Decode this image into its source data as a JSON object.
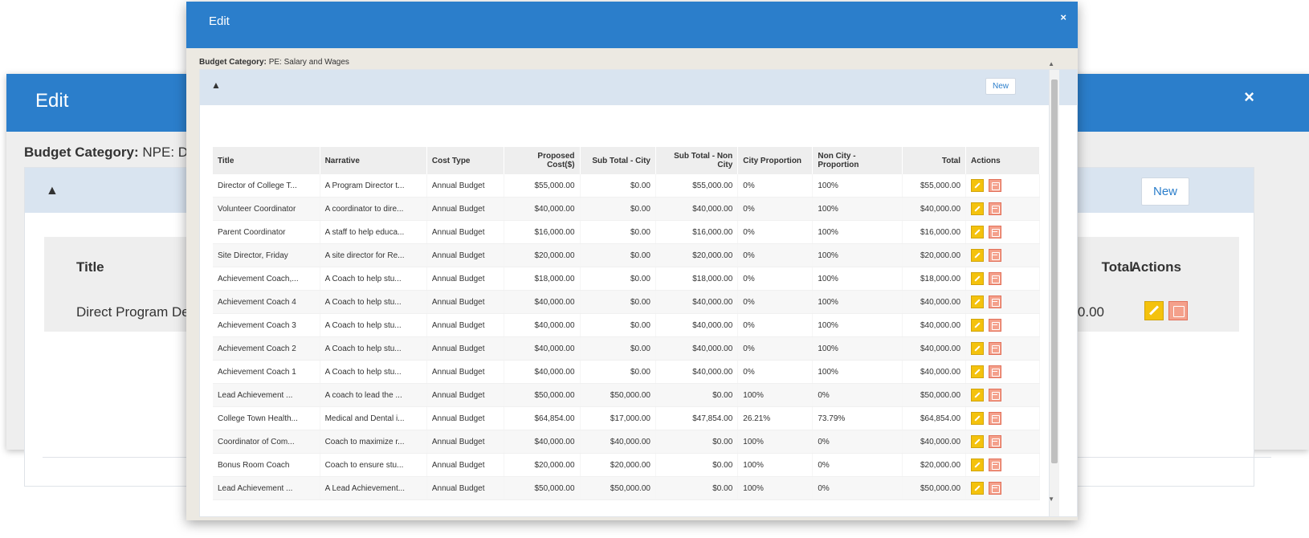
{
  "background_dialog": {
    "title": "Edit",
    "close_icon": "×",
    "budget_label": "Budget Category:",
    "budget_value": "NPE: Dir",
    "collapse_icon": "▲",
    "new_label": "New",
    "columns": {
      "title": "Title",
      "total": "Total",
      "actions": "Actions"
    },
    "row": {
      "title": "Direct Program Deliv...",
      "total": "50.00"
    }
  },
  "dialog": {
    "title": "Edit",
    "close_icon": "×",
    "budget_label": "Budget Category:",
    "budget_value": "PE: Salary and Wages",
    "collapse_icon": "▲",
    "new_label": "New",
    "scroll_up_icon": "▲",
    "scroll_down_icon": "▼",
    "columns": {
      "title": "Title",
      "narrative": "Narrative",
      "cost_type": "Cost Type",
      "proposed": "Proposed Cost($)",
      "sub_city": "Sub Total - City",
      "sub_non": "Sub Total - Non City",
      "city_prop": "City Proportion",
      "non_city_prop": "Non City - Proportion",
      "total": "Total",
      "actions": "Actions"
    },
    "rows": [
      {
        "title": "Director of College T...",
        "narrative": "A Program Director t...",
        "cost_type": "Annual Budget",
        "proposed": "$55,000.00",
        "sub_city": "$0.00",
        "sub_non": "$55,000.00",
        "city_prop": "0%",
        "non_city_prop": "100%",
        "total": "$55,000.00"
      },
      {
        "title": "Volunteer Coordinator",
        "narrative": "A coordinator to dire...",
        "cost_type": "Annual Budget",
        "proposed": "$40,000.00",
        "sub_city": "$0.00",
        "sub_non": "$40,000.00",
        "city_prop": "0%",
        "non_city_prop": "100%",
        "total": "$40,000.00"
      },
      {
        "title": "Parent Coordinator",
        "narrative": "A staff to help educa...",
        "cost_type": "Annual Budget",
        "proposed": "$16,000.00",
        "sub_city": "$0.00",
        "sub_non": "$16,000.00",
        "city_prop": "0%",
        "non_city_prop": "100%",
        "total": "$16,000.00"
      },
      {
        "title": "Site Director, Friday",
        "narrative": "A site director for Re...",
        "cost_type": "Annual Budget",
        "proposed": "$20,000.00",
        "sub_city": "$0.00",
        "sub_non": "$20,000.00",
        "city_prop": "0%",
        "non_city_prop": "100%",
        "total": "$20,000.00"
      },
      {
        "title": "Achievement Coach,...",
        "narrative": "A Coach to help stu...",
        "cost_type": "Annual Budget",
        "proposed": "$18,000.00",
        "sub_city": "$0.00",
        "sub_non": "$18,000.00",
        "city_prop": "0%",
        "non_city_prop": "100%",
        "total": "$18,000.00"
      },
      {
        "title": "Achievement Coach 4",
        "narrative": "A Coach to help stu...",
        "cost_type": "Annual Budget",
        "proposed": "$40,000.00",
        "sub_city": "$0.00",
        "sub_non": "$40,000.00",
        "city_prop": "0%",
        "non_city_prop": "100%",
        "total": "$40,000.00"
      },
      {
        "title": "Achievement Coach 3",
        "narrative": "A Coach to help stu...",
        "cost_type": "Annual Budget",
        "proposed": "$40,000.00",
        "sub_city": "$0.00",
        "sub_non": "$40,000.00",
        "city_prop": "0%",
        "non_city_prop": "100%",
        "total": "$40,000.00"
      },
      {
        "title": "Achievement Coach 2",
        "narrative": "A Coach to help stu...",
        "cost_type": "Annual Budget",
        "proposed": "$40,000.00",
        "sub_city": "$0.00",
        "sub_non": "$40,000.00",
        "city_prop": "0%",
        "non_city_prop": "100%",
        "total": "$40,000.00"
      },
      {
        "title": "Achievement Coach 1",
        "narrative": "A Coach to help stu...",
        "cost_type": "Annual Budget",
        "proposed": "$40,000.00",
        "sub_city": "$0.00",
        "sub_non": "$40,000.00",
        "city_prop": "0%",
        "non_city_prop": "100%",
        "total": "$40,000.00"
      },
      {
        "title": "Lead Achievement ...",
        "narrative": "A coach to lead the ...",
        "cost_type": "Annual Budget",
        "proposed": "$50,000.00",
        "sub_city": "$50,000.00",
        "sub_non": "$0.00",
        "city_prop": "100%",
        "non_city_prop": "0%",
        "total": "$50,000.00"
      },
      {
        "title": "College Town Health...",
        "narrative": "Medical and Dental i...",
        "cost_type": "Annual Budget",
        "proposed": "$64,854.00",
        "sub_city": "$17,000.00",
        "sub_non": "$47,854.00",
        "city_prop": "26.21%",
        "non_city_prop": "73.79%",
        "total": "$64,854.00"
      },
      {
        "title": "Coordinator of Com...",
        "narrative": "Coach to maximize r...",
        "cost_type": "Annual Budget",
        "proposed": "$40,000.00",
        "sub_city": "$40,000.00",
        "sub_non": "$0.00",
        "city_prop": "100%",
        "non_city_prop": "0%",
        "total": "$40,000.00"
      },
      {
        "title": "Bonus Room Coach",
        "narrative": "Coach to ensure stu...",
        "cost_type": "Annual Budget",
        "proposed": "$20,000.00",
        "sub_city": "$20,000.00",
        "sub_non": "$0.00",
        "city_prop": "100%",
        "non_city_prop": "0%",
        "total": "$20,000.00"
      },
      {
        "title": "Lead Achievement ...",
        "narrative": "A Lead Achievement...",
        "cost_type": "Annual Budget",
        "proposed": "$50,000.00",
        "sub_city": "$50,000.00",
        "sub_non": "$0.00",
        "city_prop": "100%",
        "non_city_prop": "0%",
        "total": "$50,000.00"
      }
    ]
  },
  "colors": {
    "header_blue": "#2b7ecb",
    "panel_head": "#d9e4f0",
    "edit_yellow": "#f4c20d",
    "delete_salmon": "#f4a08b"
  },
  "icons": {
    "close": "close-icon",
    "collapse": "caret-up-icon",
    "edit": "pencil-icon",
    "delete": "trash-icon"
  }
}
